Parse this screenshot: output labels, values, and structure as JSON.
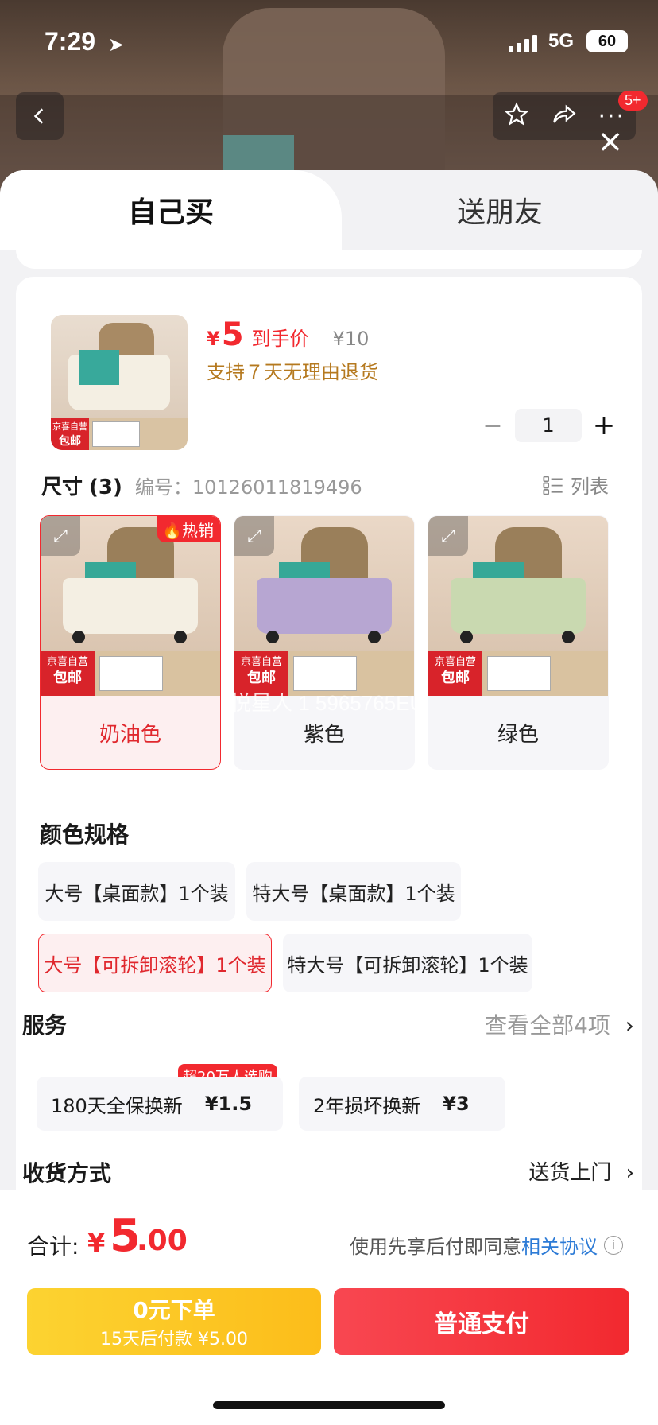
{
  "status": {
    "time": "7:29",
    "network": "5G",
    "battery": "60"
  },
  "header": {
    "notif_badge": "5+"
  },
  "tabs": {
    "buy_self": "自己买",
    "gift": "送朋友"
  },
  "product": {
    "thumb_tag_line1": "京喜自营",
    "thumb_tag_line2": "包邮",
    "price_symbol": "¥",
    "price": "5",
    "price_label": "到手价",
    "original_price": "¥10",
    "return_policy": "支持７天无理由退货",
    "quantity": "1"
  },
  "size": {
    "title": "尺寸",
    "count": "(3)",
    "code": "编号：10126011819496",
    "list_label": "列表",
    "hot_label": "热销",
    "watermark": "悦星人 1 5965765EU",
    "variants": [
      {
        "label": "奶油色",
        "color": "#f4efe3",
        "selected": true
      },
      {
        "label": "紫色",
        "color": "#b7a6d2",
        "selected": false
      },
      {
        "label": "绿色",
        "color": "#c9d9b0",
        "selected": false
      }
    ]
  },
  "color_spec": {
    "title": "颜色规格",
    "options": [
      {
        "label": "大号【桌面款】1个装",
        "selected": false
      },
      {
        "label": "特大号【桌面款】1个装",
        "selected": false
      },
      {
        "label": "大号【可拆卸滚轮】1个装",
        "selected": true
      },
      {
        "label": "特大号【可拆卸滚轮】1个装",
        "selected": false
      }
    ]
  },
  "service": {
    "title": "服务",
    "more": "查看全部4项",
    "badge": "超20万人选购",
    "options": [
      {
        "name": "180天全保换新",
        "price": "¥1.5"
      },
      {
        "name": "2年损坏换新",
        "price": "¥3"
      }
    ]
  },
  "shipping": {
    "title": "收货方式",
    "value": "送货上门"
  },
  "footer": {
    "total_label": "合计:",
    "total_symbol": "¥",
    "total_int": "5",
    "total_dec": ".00",
    "agree_text": "使用先享后付即同意",
    "agree_link": "相关协议",
    "btn_bnpl_line1": "0元下单",
    "btn_bnpl_line2": "15天后付款 ¥5.00",
    "btn_pay": "普通支付"
  },
  "colors": {
    "accent_red": "#f2292f",
    "gold": "#fcc623",
    "link_blue": "#2d7bd6"
  }
}
